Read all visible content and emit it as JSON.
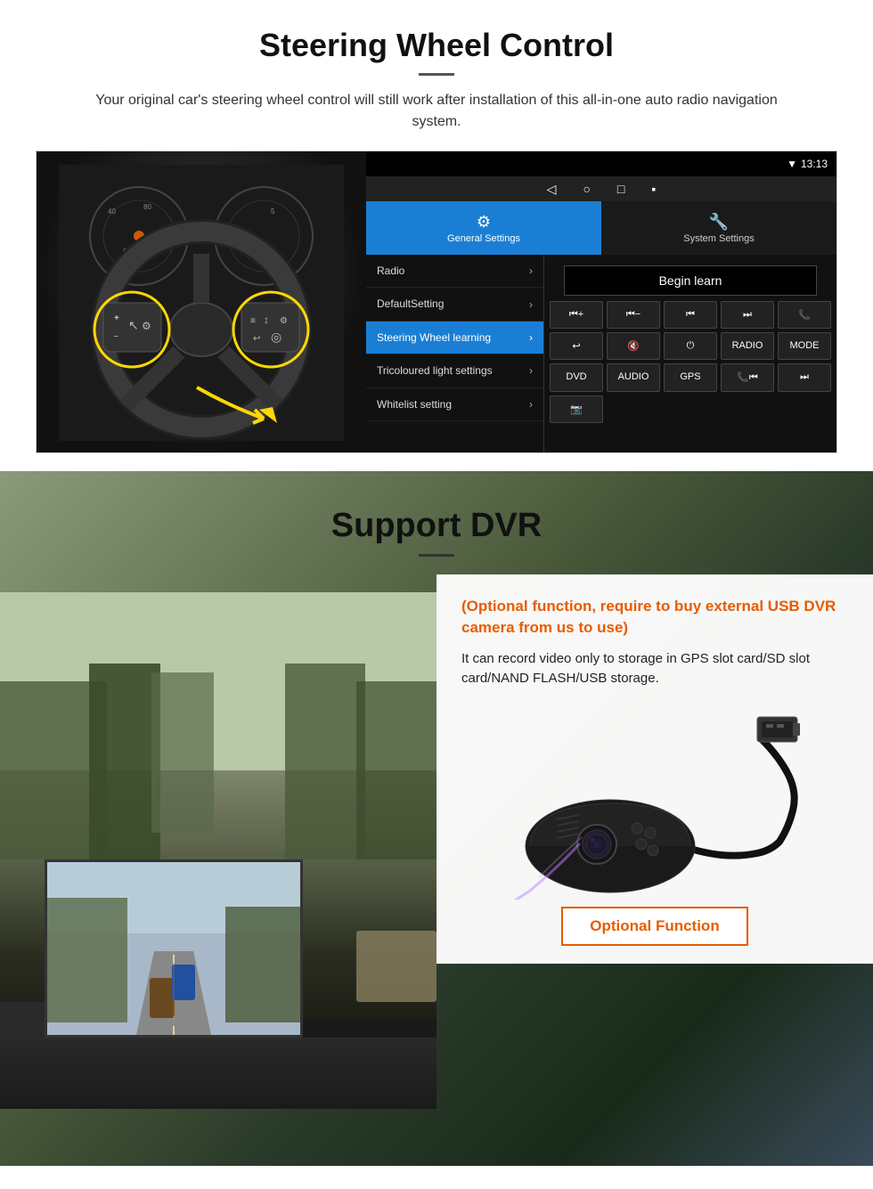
{
  "steering": {
    "title": "Steering Wheel Control",
    "description": "Your original car's steering wheel control will still work after installation of this all-in-one auto radio navigation system.",
    "status_bar": {
      "time": "13:13",
      "icons": "▼ ◀"
    },
    "tabs": {
      "general": "General Settings",
      "system": "System Settings"
    },
    "menu_items": [
      {
        "label": "Radio",
        "active": false
      },
      {
        "label": "DefaultSetting",
        "active": false
      },
      {
        "label": "Steering Wheel learning",
        "active": true
      },
      {
        "label": "Tricoloured light settings",
        "active": false
      },
      {
        "label": "Whitelist setting",
        "active": false
      }
    ],
    "begin_learn": "Begin learn",
    "control_buttons": [
      {
        "label": "⏮+",
        "id": "vol-up"
      },
      {
        "label": "⏮-",
        "id": "vol-down"
      },
      {
        "label": "⏮",
        "id": "prev"
      },
      {
        "label": "⏭",
        "id": "next"
      },
      {
        "label": "📞",
        "id": "call"
      },
      {
        "label": "↩",
        "id": "back"
      },
      {
        "label": "🔇",
        "id": "mute"
      },
      {
        "label": "⏻",
        "id": "power"
      },
      {
        "label": "RADIO",
        "id": "radio"
      },
      {
        "label": "MODE",
        "id": "mode"
      },
      {
        "label": "DVD",
        "id": "dvd"
      },
      {
        "label": "AUDIO",
        "id": "audio"
      },
      {
        "label": "GPS",
        "id": "gps"
      },
      {
        "label": "📞⏮",
        "id": "call-prev"
      },
      {
        "label": "⏭",
        "id": "call-next"
      },
      {
        "label": "📷",
        "id": "camera"
      }
    ]
  },
  "dvr": {
    "title": "Support DVR",
    "optional_text": "(Optional function, require to buy external USB DVR camera from us to use)",
    "description": "It can record video only to storage in GPS slot card/SD slot card/NAND FLASH/USB storage.",
    "optional_function_label": "Optional Function"
  }
}
